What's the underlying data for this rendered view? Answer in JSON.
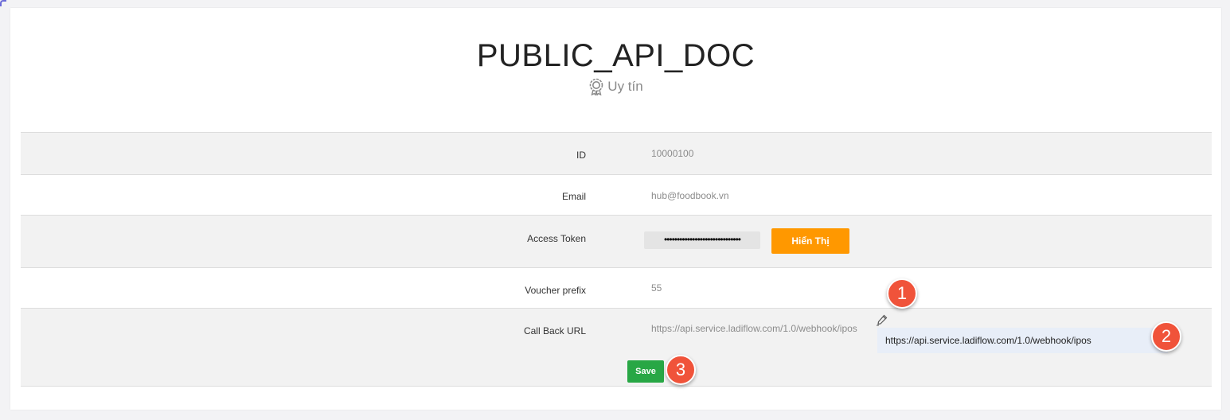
{
  "page": {
    "title": "PUBLIC_API_DOC",
    "badge_icon": "award-icon",
    "badge_label": "Uy tín"
  },
  "fields": {
    "id": {
      "label": "ID",
      "value": "10000100"
    },
    "email": {
      "label": "Email",
      "value": "hub@foodbook.vn"
    },
    "access_token": {
      "label": "Access Token",
      "masked_value": "••••••••••••••••••••••••••••••",
      "show_button_label": "Hiển Thị"
    },
    "voucher_prefix": {
      "label": "Voucher prefix",
      "value": "55"
    },
    "callback_url": {
      "label": "Call Back URL",
      "value": "https://api.service.ladiflow.com/1.0/webhook/ipos",
      "edit_icon": "pencil-icon",
      "input_value": "https://api.service.ladiflow.com/1.0/webhook/ipos"
    }
  },
  "actions": {
    "save_label": "Save"
  },
  "annotations": [
    "1",
    "2",
    "3"
  ],
  "colors": {
    "show_button": "#ff9800",
    "save_button": "#28a745",
    "annotation_badge": "#f0533a"
  }
}
